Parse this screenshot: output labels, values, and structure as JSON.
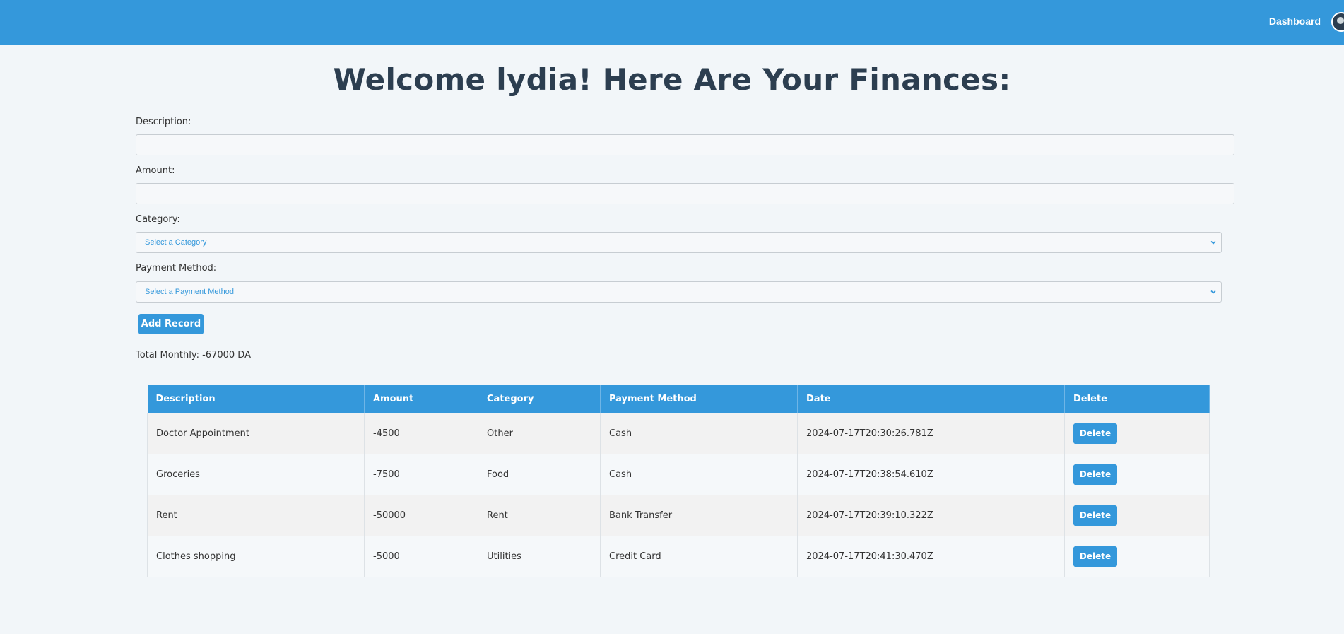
{
  "nav": {
    "dashboard_label": "Dashboard"
  },
  "heading": "Welcome lydia! Here Are Your Finances:",
  "form": {
    "description_label": "Description:",
    "description_value": "",
    "amount_label": "Amount:",
    "amount_value": "",
    "category_label": "Category:",
    "category_selected": "Select a Category",
    "payment_label": "Payment Method:",
    "payment_selected": "Select a Payment Method",
    "add_button": "Add Record"
  },
  "total_monthly": "Total Monthly: -67000 DA",
  "table": {
    "headers": [
      "Description",
      "Amount",
      "Category",
      "Payment Method",
      "Date",
      "Delete"
    ],
    "rows": [
      {
        "description": "Doctor Appointment",
        "amount": "-4500",
        "category": "Other",
        "payment": "Cash",
        "date": "2024-07-17T20:30:26.781Z",
        "delete": "Delete"
      },
      {
        "description": "Groceries",
        "amount": "-7500",
        "category": "Food",
        "payment": "Cash",
        "date": "2024-07-17T20:38:54.610Z",
        "delete": "Delete"
      },
      {
        "description": "Rent",
        "amount": "-50000",
        "category": "Rent",
        "payment": "Bank Transfer",
        "date": "2024-07-17T20:39:10.322Z",
        "delete": "Delete"
      },
      {
        "description": "Clothes shopping",
        "amount": "-5000",
        "category": "Utilities",
        "payment": "Credit Card",
        "date": "2024-07-17T20:41:30.470Z",
        "delete": "Delete"
      }
    ]
  },
  "colors": {
    "primary": "#3498db",
    "heading": "#2c3e50",
    "background": "#f2f6f9"
  }
}
